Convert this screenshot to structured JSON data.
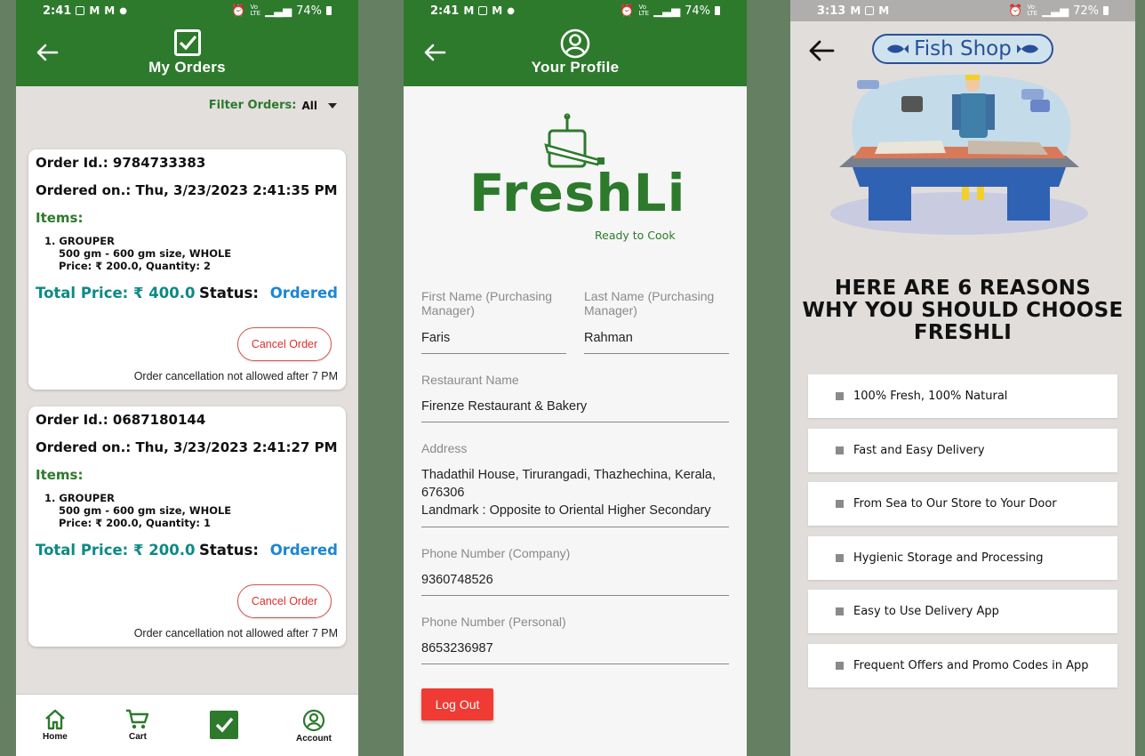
{
  "orders_screen": {
    "status": {
      "time": "2:41",
      "battery": "74%"
    },
    "title": "My Orders",
    "filter": {
      "label": "Filter Orders:",
      "value": "All"
    },
    "orders": [
      {
        "id_line": "Order Id.: 9784733383",
        "date_line": "Ordered on.: Thu, 3/23/2023 2:41:35 PM",
        "items_heading": "Items:",
        "item_name": "1. GROUPER",
        "item_size": "500 gm - 600 gm size, WHOLE",
        "item_price": "Price: ₹ 200.0, Quantity: 2",
        "total": "Total Price: ₹ 400.0",
        "status_label": "Status:",
        "status_value": "Ordered",
        "cancel_label": "Cancel Order",
        "note": "Order cancellation not allowed after 7 PM"
      },
      {
        "id_line": "Order Id.: 0687180144",
        "date_line": "Ordered on.: Thu, 3/23/2023 2:41:27 PM",
        "items_heading": "Items:",
        "item_name": "1. GROUPER",
        "item_size": "500 gm - 600 gm size, WHOLE",
        "item_price": "Price: ₹ 200.0, Quantity: 1",
        "total": "Total Price: ₹ 200.0",
        "status_label": "Status:",
        "status_value": "Ordered",
        "cancel_label": "Cancel Order",
        "note": "Order cancellation not allowed after 7 PM"
      }
    ],
    "nav": {
      "home": "Home",
      "cart": "Cart",
      "account": "Account"
    }
  },
  "profile_screen": {
    "status": {
      "time": "2:41",
      "battery": "74%"
    },
    "title": "Your Profile",
    "logo_text": "FreshLi",
    "logo_tagline": "Ready to Cook",
    "fields": {
      "first_name_label": "First Name (Purchasing Manager)",
      "first_name_value": "Faris",
      "last_name_label": "Last Name (Purchasing Manager)",
      "last_name_value": "Rahman",
      "restaurant_label": "Restaurant Name",
      "restaurant_value": "Firenze Restaurant & Bakery",
      "address_label": "Address",
      "address_line1": "Thadathil House, Tirurangadi, Thazhechina, Kerala,",
      "address_line2": "676306",
      "address_line3": "Landmark : Opposite to Oriental Higher Secondary",
      "phone_company_label": "Phone Number (Company)",
      "phone_company_value": "9360748526",
      "phone_personal_label": "Phone Number (Personal)",
      "phone_personal_value": "8653236987"
    },
    "logout_label": "Log Out"
  },
  "fishshop_screen": {
    "status": {
      "time": "3:13",
      "battery": "72%"
    },
    "badge_title": "Fish Shop",
    "heading_line1": "HERE ARE 6 REASONS",
    "heading_line2": "WHY YOU SHOULD CHOOSE",
    "heading_line3": "FRESHLI",
    "reasons": [
      "100% Fresh, 100% Natural",
      "Fast and Easy Delivery",
      "From Sea to Our Store to Your Door",
      "Hygienic Storage and Processing",
      "Easy to Use Delivery App",
      "Frequent Offers and Promo Codes in App"
    ]
  },
  "colors": {
    "brand_green": "#2d7a2d",
    "total_teal": "#0c8a86",
    "status_blue": "#1b86d6",
    "cancel_red": "#d9312b",
    "logout_red": "#ef3b33",
    "badge_blue": "#2a4f9a"
  },
  "icons": [
    "back-arrow-icon",
    "checkbox-icon",
    "profile-icon",
    "home-icon",
    "cart-icon",
    "account-icon",
    "fish-icon",
    "dropdown-caret-icon"
  ]
}
